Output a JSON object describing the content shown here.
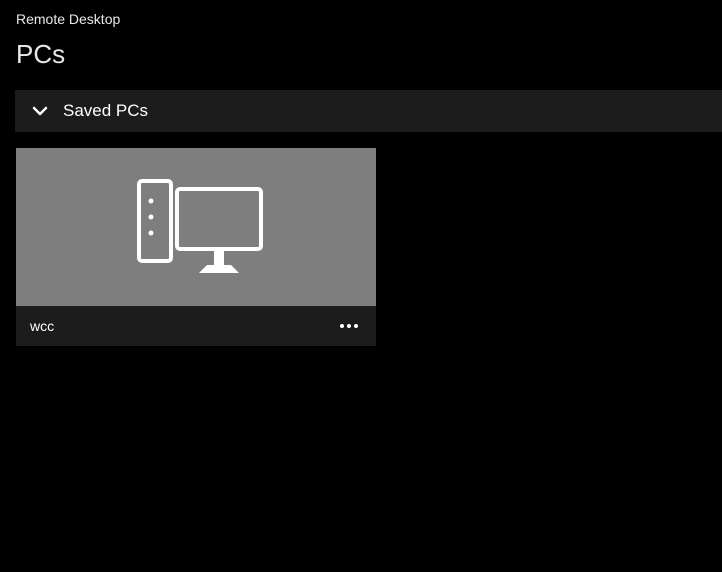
{
  "app": {
    "title": "Remote Desktop"
  },
  "header": {
    "page_title": "PCs"
  },
  "sections": {
    "saved_pcs": {
      "title": "Saved PCs",
      "items": [
        {
          "name": "wcc",
          "icon": "desktop-pc-icon"
        }
      ]
    }
  }
}
